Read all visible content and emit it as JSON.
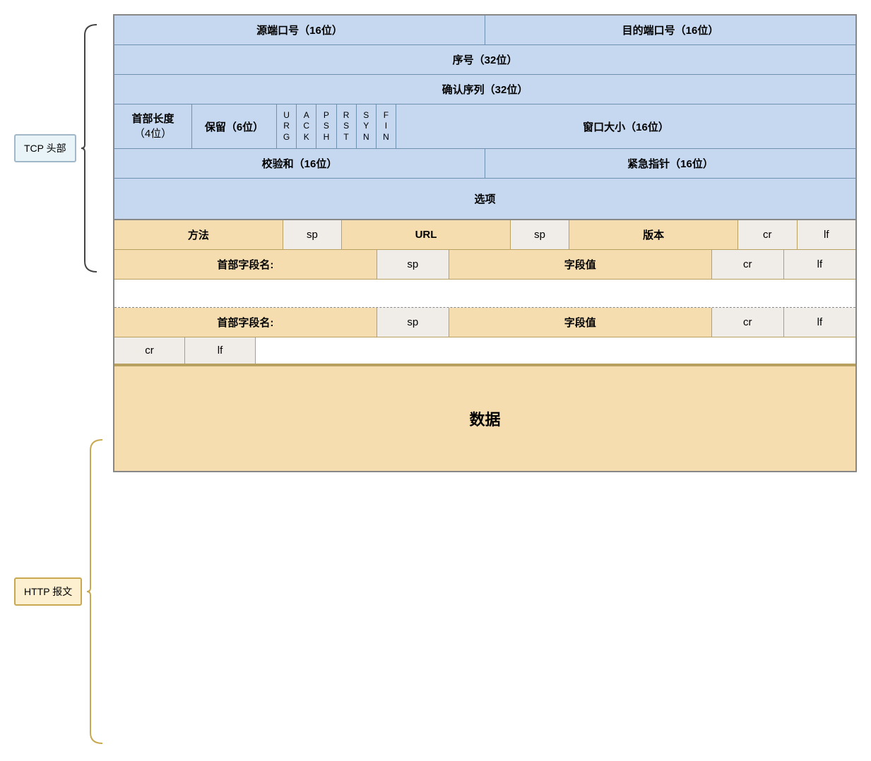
{
  "tcp_label": "TCP 头部",
  "http_label": "HTTP 报文",
  "tcp": {
    "row1": {
      "left": "源端口号（16位）",
      "right": "目的端口号（16位）"
    },
    "row2": "序号（32位）",
    "row3": "确认序列（32位）",
    "row4": {
      "header_len_label": "首部长度",
      "header_len_bits": "（4位）",
      "reserved_label": "保留（6位）",
      "flags": [
        "U\nR\nG",
        "A\nC\nK",
        "P\nS\nH",
        "R\nS\nT",
        "S\nY\nN",
        "F\nI\nN"
      ],
      "window_label": "窗口大小（16位）"
    },
    "row5": {
      "left": "校验和（16位）",
      "right": "紧急指针（16位）"
    },
    "row6": "选项"
  },
  "http": {
    "row1": {
      "cells": [
        "方法",
        "sp",
        "URL",
        "sp",
        "版本",
        "cr",
        "lf"
      ]
    },
    "row2": {
      "cells": [
        "首部字段名:",
        "sp",
        "字段值",
        "cr",
        "lf"
      ]
    },
    "row3_dashed": true,
    "row4": {
      "cells": [
        "首部字段名:",
        "sp",
        "字段值",
        "cr",
        "lf"
      ]
    },
    "row5": {
      "cells": [
        "cr",
        "lf"
      ]
    },
    "data": "数据"
  }
}
